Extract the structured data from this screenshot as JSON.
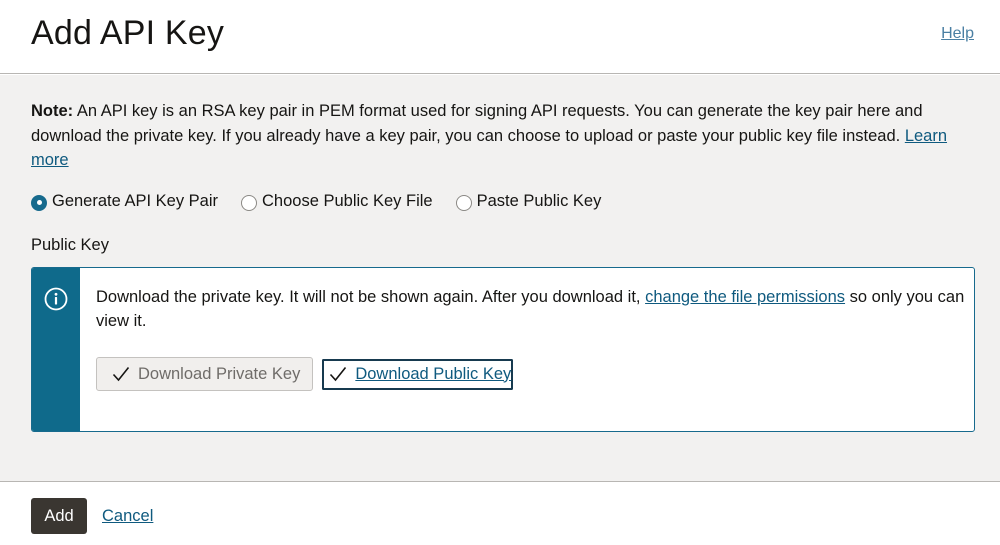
{
  "header": {
    "title": "Add API Key",
    "help_label": "Help"
  },
  "note": {
    "label": "Note:",
    "text": " An API key is an RSA key pair in PEM format used for signing API requests. You can generate the key pair here and download the private key. If you already have a key pair, you can choose to upload or paste your public key file instead. ",
    "link_label": "Learn more"
  },
  "options": {
    "generate": {
      "label": "Generate API Key Pair",
      "selected": true
    },
    "choose_file": {
      "label": "Choose Public Key File",
      "selected": false
    },
    "paste": {
      "label": "Paste Public Key",
      "selected": false
    }
  },
  "public_key": {
    "label": "Public Key",
    "info_text_before": "Download the private key. It will not be shown again. After you download it, ",
    "info_link": "change the file permissions",
    "info_text_after": " so only you can view it.",
    "download_private_label": "Download Private Key",
    "download_public_label": "Download Public Key"
  },
  "footer": {
    "add_label": "Add",
    "cancel_label": "Cancel"
  },
  "colors": {
    "accent": "#176a8d",
    "info_bar": "#0f6a8b",
    "link": "#0f5a7f",
    "primary_button": "#3a3631",
    "body_background": "#f2f1f0"
  },
  "icons": {
    "info": "info-circle-icon",
    "check": "check-icon"
  }
}
